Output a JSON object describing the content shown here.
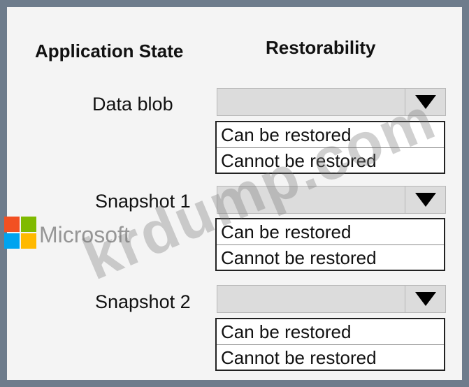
{
  "headers": {
    "application_state": "Application State",
    "restorability": "Restorability"
  },
  "rows": [
    {
      "label": "Data blob",
      "options": [
        "Can be restored",
        "Cannot be restored"
      ]
    },
    {
      "label": "Snapshot 1",
      "options": [
        "Can be restored",
        "Cannot be restored"
      ]
    },
    {
      "label": "Snapshot 2",
      "options": [
        "Can be restored",
        "Cannot be restored"
      ]
    }
  ],
  "watermark": {
    "site_text": "krdump.com",
    "brand_text": "Microsoft",
    "logo_colors": [
      "#f25022",
      "#7fba00",
      "#00a4ef",
      "#ffb900"
    ]
  },
  "icons": {
    "dropdown_arrow": "chevron-down-icon"
  }
}
